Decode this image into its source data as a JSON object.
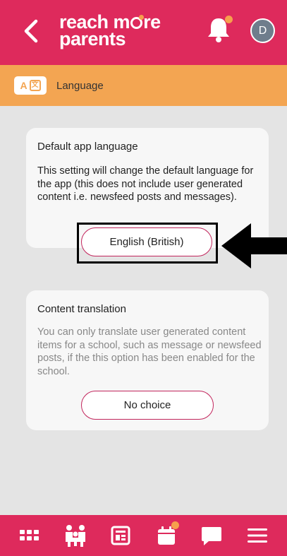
{
  "header": {
    "back_icon": "chevron-left-icon",
    "logo_line1_a": "reach m",
    "logo_line1_b": "re",
    "logo_line2": "parents",
    "notification_icon": "bell-icon",
    "avatar_initial": "D"
  },
  "subheader": {
    "icon": "translate-icon",
    "icon_letter_a": "A",
    "icon_letter_b": "文",
    "title": "Language"
  },
  "cards": {
    "default_language": {
      "title": "Default app language",
      "description": "This setting will change the default language for the app (this does not include user generated content i.e. newsfeed posts and messages).",
      "button_label": "English (British)"
    },
    "content_translation": {
      "title": "Content translation",
      "description": "You can only translate user generated content items for a school, such as message or newsfeed posts, if the this option has been enabled for the school.",
      "button_label": "No choice"
    }
  },
  "bottom_nav": {
    "items": [
      "apps-grid-icon",
      "family-icon",
      "newsfeed-icon",
      "calendar-icon",
      "messages-icon",
      "menu-icon"
    ]
  },
  "colors": {
    "brand": "#de2a5c",
    "accent": "#f3a552",
    "notification_dot": "#f6a04d"
  }
}
